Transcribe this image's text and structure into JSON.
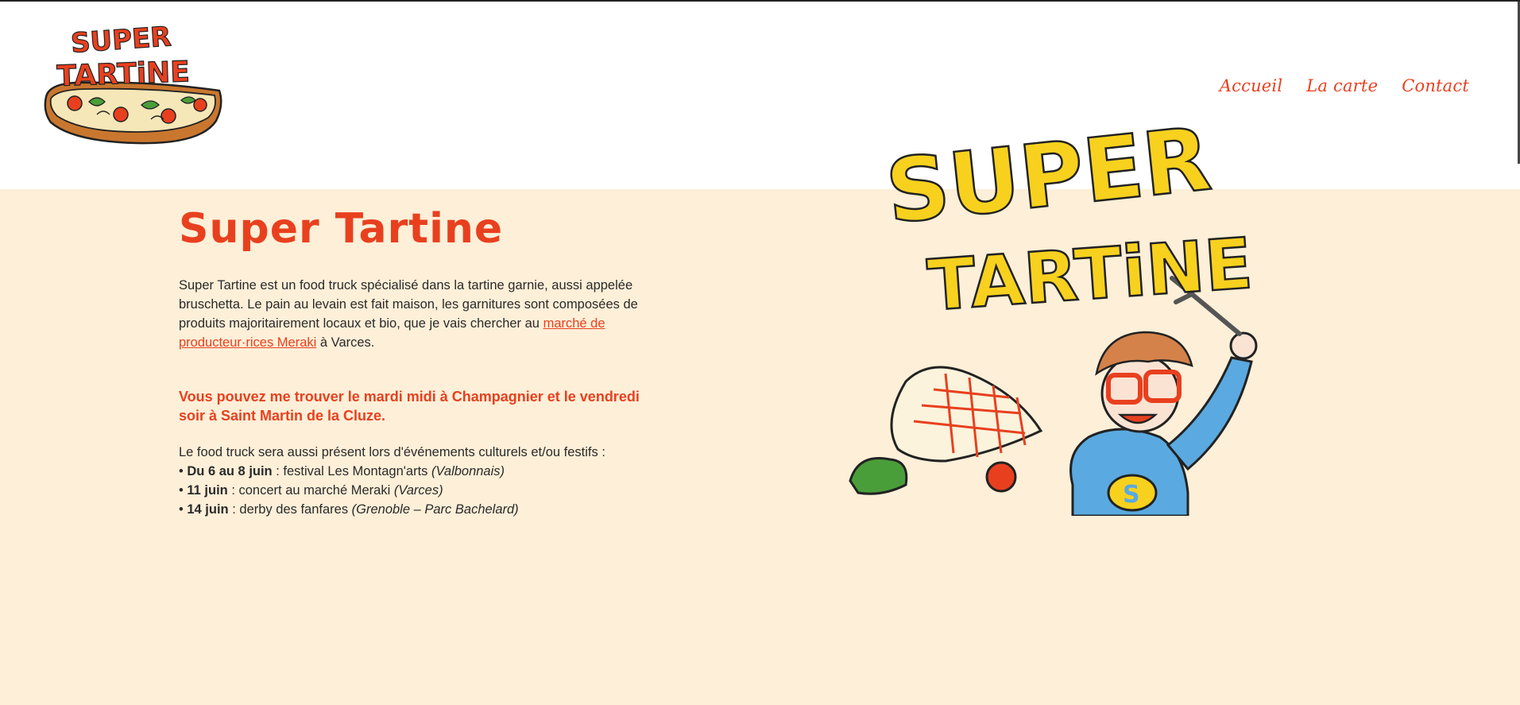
{
  "brand": {
    "logo_text_line1": "SUPER",
    "logo_text_line2": "TARTiNE"
  },
  "nav": {
    "items": [
      {
        "label": "Accueil"
      },
      {
        "label": "La carte"
      },
      {
        "label": "Contact"
      }
    ]
  },
  "main": {
    "title": "Super Tartine",
    "intro_text": "Super Tartine est un food truck spécialisé dans la tartine garnie, aussi appelée bruschetta. Le pain au levain est fait maison, les garnitures sont composées de produits majoritairement locaux et bio, que je vais chercher au ",
    "intro_link": "marché de producteur·rices Meraki",
    "intro_after": " à Varces.",
    "highlight": "Vous pouvez me trouver le mardi midi à Champagnier et le vendredi soir à Saint Martin de la Cluze.",
    "events_intro": "Le food truck sera aussi présent lors d'événements culturels et/ou festifs :",
    "events": [
      {
        "bullet": "•",
        "date": "Du 6 au 8 juin",
        "sep": " : ",
        "desc": "festival Les Montagn'arts ",
        "place": "(Valbonnais)"
      },
      {
        "bullet": "•",
        "date": "11 juin",
        "sep": " : ",
        "desc": "concert au marché Meraki ",
        "place": "(Varces)"
      },
      {
        "bullet": "•",
        "date": "14 juin",
        "sep": " : ",
        "desc": "derby des fanfares ",
        "place": "(Grenoble – Parc Bachelard)"
      }
    ]
  },
  "illustration": {
    "line1": "SUPER",
    "line2": "TARTiNE"
  },
  "colors": {
    "accent": "#e8401f",
    "hero_bg": "#fdefd8",
    "yellow": "#f7d11e",
    "blue": "#5aa9e0"
  }
}
